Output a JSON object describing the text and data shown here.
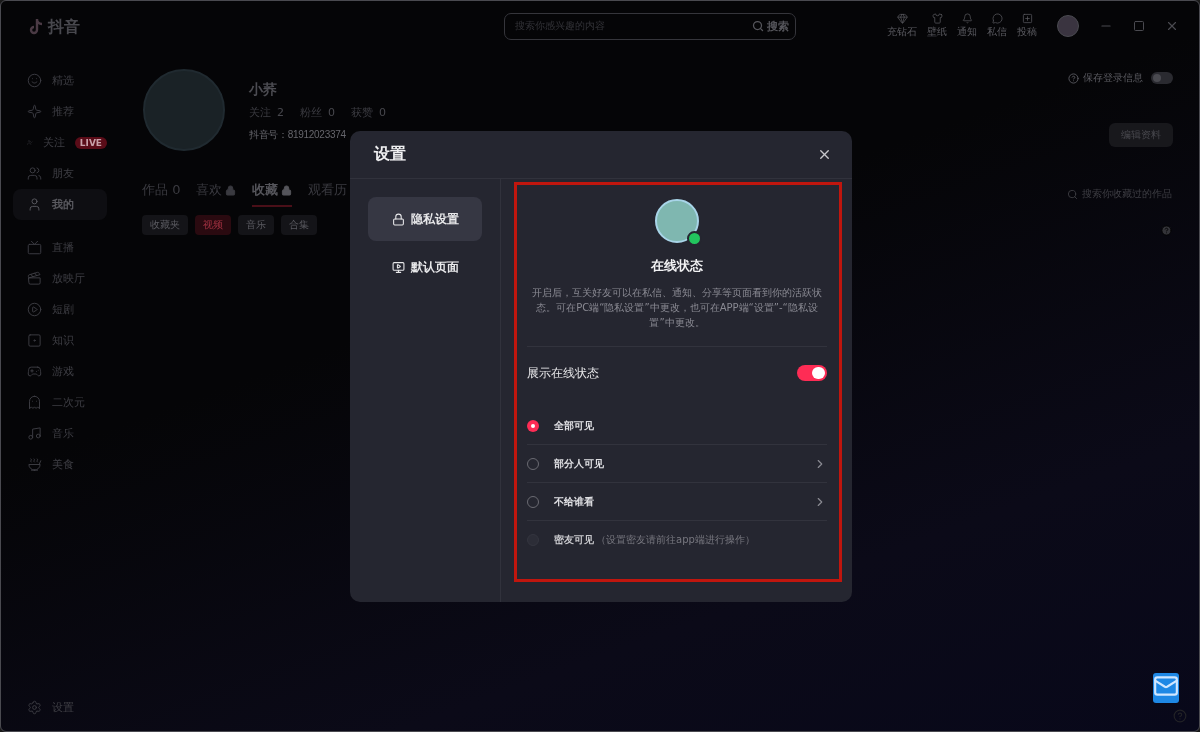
{
  "app": {
    "logo": "抖音"
  },
  "sidebar": {
    "items": [
      {
        "label": "精选",
        "selected": false
      },
      {
        "label": "推荐",
        "selected": false
      },
      {
        "label": "关注",
        "selected": false,
        "badge": "LIVE"
      },
      {
        "label": "朋友",
        "selected": false
      },
      {
        "label": "我的",
        "selected": true
      },
      {
        "label": "直播",
        "selected": false
      },
      {
        "label": "放映厅",
        "selected": false
      },
      {
        "label": "短剧",
        "selected": false
      },
      {
        "label": "知识",
        "selected": false
      },
      {
        "label": "游戏",
        "selected": false
      },
      {
        "label": "二次元",
        "selected": false
      },
      {
        "label": "音乐",
        "selected": false
      },
      {
        "label": "美食",
        "selected": false
      }
    ],
    "settings": "设置"
  },
  "topbar": {
    "search": {
      "placeholder": "搜索你感兴趣的内容",
      "button": "搜索"
    },
    "actions": [
      {
        "label": "充钻石"
      },
      {
        "label": "壁纸"
      },
      {
        "label": "通知"
      },
      {
        "label": "私信"
      },
      {
        "label": "投稿"
      }
    ]
  },
  "profile": {
    "name": "小荞",
    "stats": [
      {
        "label": "关注",
        "value": "2"
      },
      {
        "label": "粉丝",
        "value": "0"
      },
      {
        "label": "获赞",
        "value": "0"
      }
    ],
    "id": "抖音号：81912023374",
    "save_login": {
      "label": "保存登录信息",
      "on": false
    },
    "edit_button": "编辑资料"
  },
  "tabs": [
    {
      "label": "作品 0",
      "locked": false,
      "selected": false
    },
    {
      "label": "喜欢",
      "locked": true,
      "selected": false
    },
    {
      "label": "收藏",
      "locked": true,
      "selected": true
    },
    {
      "label": "观看历",
      "locked": false,
      "selected": false
    }
  ],
  "chips": [
    {
      "label": "收藏夹",
      "selected": false
    },
    {
      "label": "视频",
      "selected": true
    },
    {
      "label": "音乐",
      "selected": false
    },
    {
      "label": "合集",
      "selected": false
    }
  ],
  "collection_search": {
    "placeholder": "搜索你收藏过的作品"
  },
  "dialog": {
    "title": "设置",
    "menu": [
      {
        "label": "隐私设置",
        "selected": true
      },
      {
        "label": "默认页面",
        "selected": false
      }
    ],
    "panel": {
      "title": "在线状态",
      "online": true,
      "description": "开启后，互关好友可以在私信、通知、分享等页面看到你的活跃状态。可在PC端“隐私设置”中更改，也可在APP端“设置”-“隐私设置”中更改。",
      "toggle": {
        "label": "展示在线状态",
        "on": true
      },
      "options": [
        {
          "label": "全部可见",
          "selected": true,
          "disabled": false,
          "chevron": false
        },
        {
          "label": "部分人可见",
          "selected": false,
          "disabled": false,
          "chevron": true
        },
        {
          "label": "不给谁看",
          "selected": false,
          "disabled": false,
          "chevron": true
        },
        {
          "label": "密友可见",
          "note": "（设置密友请前往app端进行操作）",
          "selected": false,
          "disabled": true,
          "chevron": false
        }
      ]
    }
  }
}
